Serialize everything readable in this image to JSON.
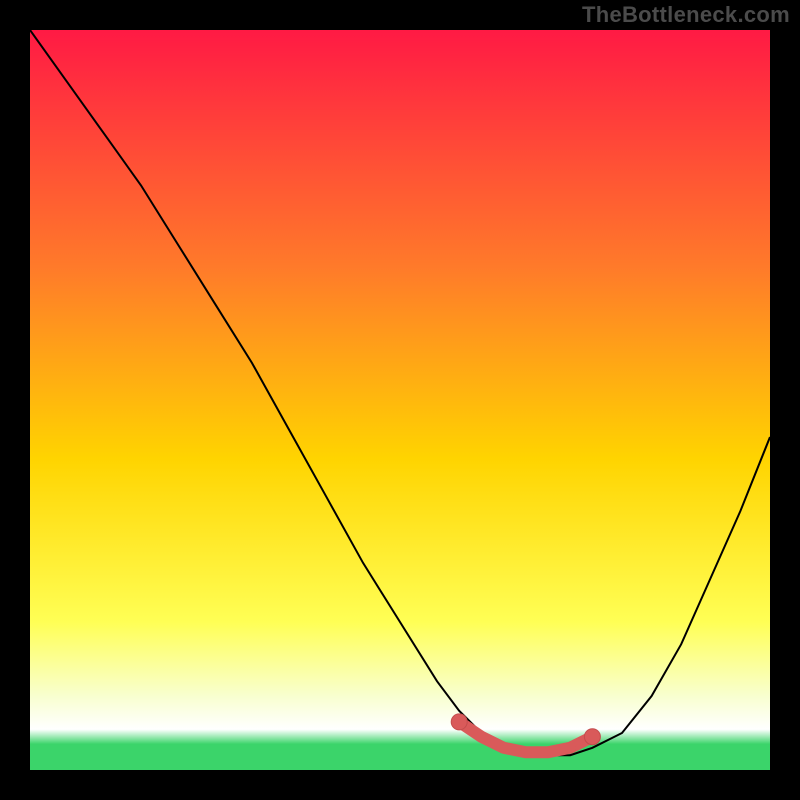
{
  "watermark": "TheBottleneck.com",
  "colors": {
    "frame": "#000000",
    "watermark": "#4b4b4b",
    "gradient_top": "#ff1a44",
    "gradient_mid1": "#ff7a2a",
    "gradient_mid2": "#ffd400",
    "gradient_mid3": "#ffff55",
    "gradient_mid4": "#f8ffcf",
    "gradient_bottom_band": "#ffffff",
    "gradient_bottom": "#3bd46a",
    "curve": "#000000",
    "marker_fill": "#d95a5a",
    "marker_stroke": "#c44d4d"
  },
  "chart_data": {
    "type": "line",
    "title": "",
    "xlabel": "",
    "ylabel": "",
    "xlim": [
      0,
      100
    ],
    "ylim": [
      0,
      100
    ],
    "axes_visible": false,
    "grid": false,
    "series": [
      {
        "name": "bottleneck-curve",
        "x": [
          0,
          5,
          10,
          15,
          20,
          25,
          30,
          35,
          40,
          45,
          50,
          55,
          58,
          61,
          64,
          67,
          70,
          73,
          76,
          80,
          84,
          88,
          92,
          96,
          100
        ],
        "y": [
          100,
          93,
          86,
          79,
          71,
          63,
          55,
          46,
          37,
          28,
          20,
          12,
          8,
          5,
          3,
          2,
          2,
          2,
          3,
          5,
          10,
          17,
          26,
          35,
          45
        ]
      }
    ],
    "markers": {
      "name": "optimal-range",
      "x": [
        58,
        61,
        64,
        67,
        70,
        73,
        76
      ],
      "y": [
        6.5,
        4.5,
        3,
        2.4,
        2.4,
        3,
        4.5
      ]
    },
    "background_gradient": {
      "orientation": "vertical",
      "stops": [
        {
          "offset": 0.0,
          "color": "#ff1a44"
        },
        {
          "offset": 0.32,
          "color": "#ff7a2a"
        },
        {
          "offset": 0.58,
          "color": "#ffd400"
        },
        {
          "offset": 0.8,
          "color": "#ffff55"
        },
        {
          "offset": 0.9,
          "color": "#f8ffcf"
        },
        {
          "offset": 0.945,
          "color": "#ffffff"
        },
        {
          "offset": 0.965,
          "color": "#3bd46a"
        },
        {
          "offset": 1.0,
          "color": "#3bd46a"
        }
      ]
    }
  }
}
